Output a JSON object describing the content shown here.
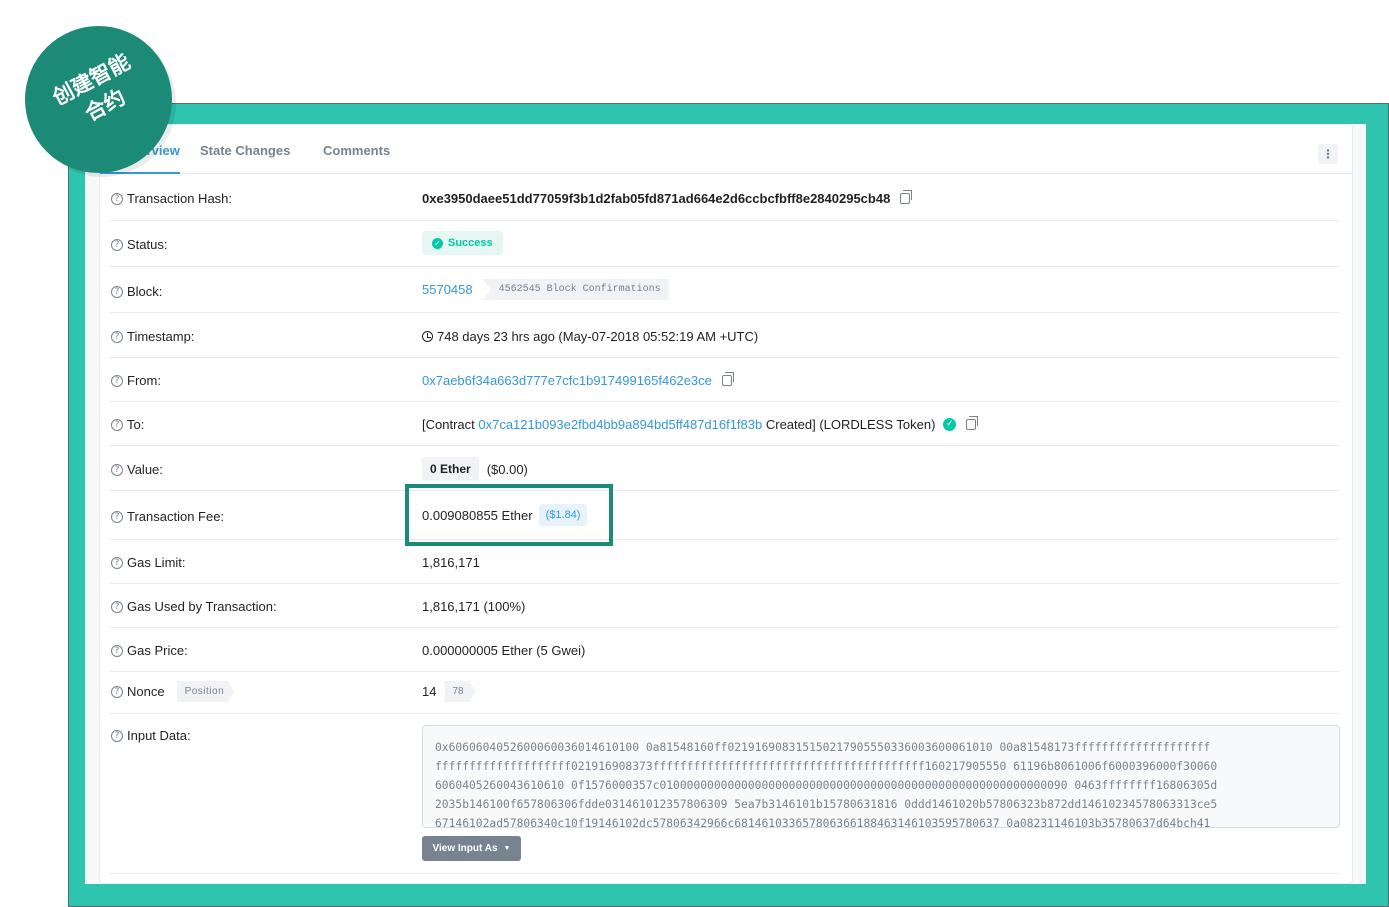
{
  "badge": {
    "line1": "创建智能",
    "line2": "合约"
  },
  "tabs": [
    {
      "label": "Overview"
    },
    {
      "label": "State Changes"
    },
    {
      "label": "Comments"
    }
  ],
  "more_icon": "⋮",
  "rows": {
    "hash": {
      "label": "Transaction Hash:",
      "value": "0xe3950daee51dd77059f3b1d2fab05fd871ad664e2d6ccbcfbff8e2840295cb48"
    },
    "status": {
      "label": "Status:",
      "value": "Success"
    },
    "block": {
      "label": "Block:",
      "value": "5570458",
      "confirmations": "4562545 Block Confirmations"
    },
    "timestamp": {
      "label": "Timestamp:",
      "value": "748 days 23 hrs ago (May-07-2018 05:52:19 AM +UTC)"
    },
    "from": {
      "label": "From:",
      "value": "0x7aeb6f34a663d777e7cfc1b917499165f462e3ce"
    },
    "to": {
      "label": "To:",
      "prefix": "[Contract ",
      "address": "0x7ca121b093e2fbd4bb9a894bd5ff487d16f1f83b",
      "suffix": " Created] (LORDLESS Token)"
    },
    "value": {
      "label": "Value:",
      "tag": "0 Ether",
      "usd": "($0.00)"
    },
    "fee": {
      "label": "Transaction Fee:",
      "value": "0.009080855 Ether",
      "usd": "($1.84)"
    },
    "gas_limit": {
      "label": "Gas Limit:",
      "value": "1,816,171"
    },
    "gas_used": {
      "label": "Gas Used by Transaction:",
      "value": "1,816,171 (100%)"
    },
    "gas_price": {
      "label": "Gas Price:",
      "value": "0.000000005 Ether (5 Gwei)"
    },
    "nonce": {
      "label": "Nonce",
      "position_tag": "Position",
      "value": "14",
      "position_value": "78"
    },
    "input": {
      "label": "Input Data:",
      "lines": [
        "0x6060604052600060036014610100 0a81548160ff021916908315150217905550336003600061010 00a81548173ffffffffffffffffffff",
        "ffffffffffffffffffff021916908373ffffffffffffffffffffffffffffffffffffffff160217905550 61196b8061006f6000396000f30060",
        "6060405260043610610 0f1576000357c010000000000000000000000000000000000000000000000000000000090 0463ffffffff16806305d",
        "2035b146100f657806306fdde031461012357806309 5ea7b3146101b15780631816 0ddd1461020b57806323b872dd14610234578063313ce5",
        "67146102ad57806340c10f19146102dc57806342966c681461033657806366188463146103595780637 0a08231146103b35780637d64bch41"
      ],
      "button": "View Input As"
    }
  },
  "colors": {
    "teal_frame": "#2ec4ae",
    "badge_green": "#1b8a76",
    "link_blue": "#3498db",
    "success": "#00c9a7"
  }
}
